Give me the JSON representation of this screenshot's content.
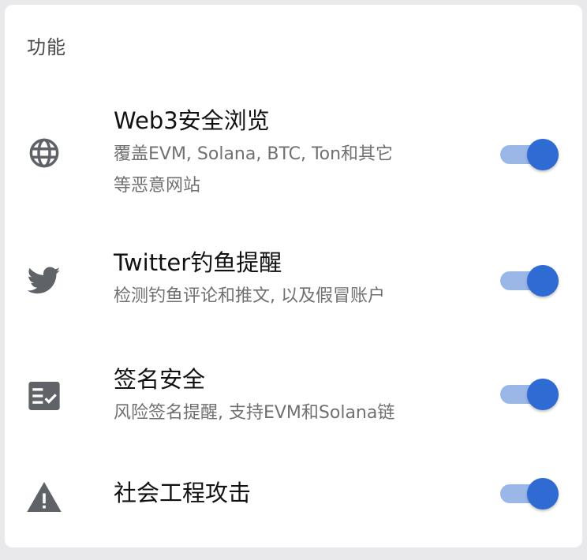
{
  "section": {
    "title": "功能"
  },
  "features": [
    {
      "title": "Web3安全浏览",
      "desc_line1": "覆盖EVM, Solana, BTC, Ton和其它",
      "desc_line2": "等恶意网站",
      "icon": "globe-icon",
      "enabled": true
    },
    {
      "title": "Twitter钓鱼提醒",
      "desc_line1": "检测钓鱼评论和推文, 以及假冒账户",
      "icon": "twitter-bird-icon",
      "enabled": true
    },
    {
      "title": "签名安全",
      "desc_line1": "风险签名提醒, 支持EVM和Solana链",
      "icon": "checklist-icon",
      "enabled": true
    },
    {
      "title": "社会工程攻击",
      "icon": "warning-icon",
      "enabled": true
    }
  ],
  "colors": {
    "toggle_on_knob": "#2f6bd3",
    "toggle_on_track": "#9ab7e8",
    "icon": "#5f6368"
  }
}
